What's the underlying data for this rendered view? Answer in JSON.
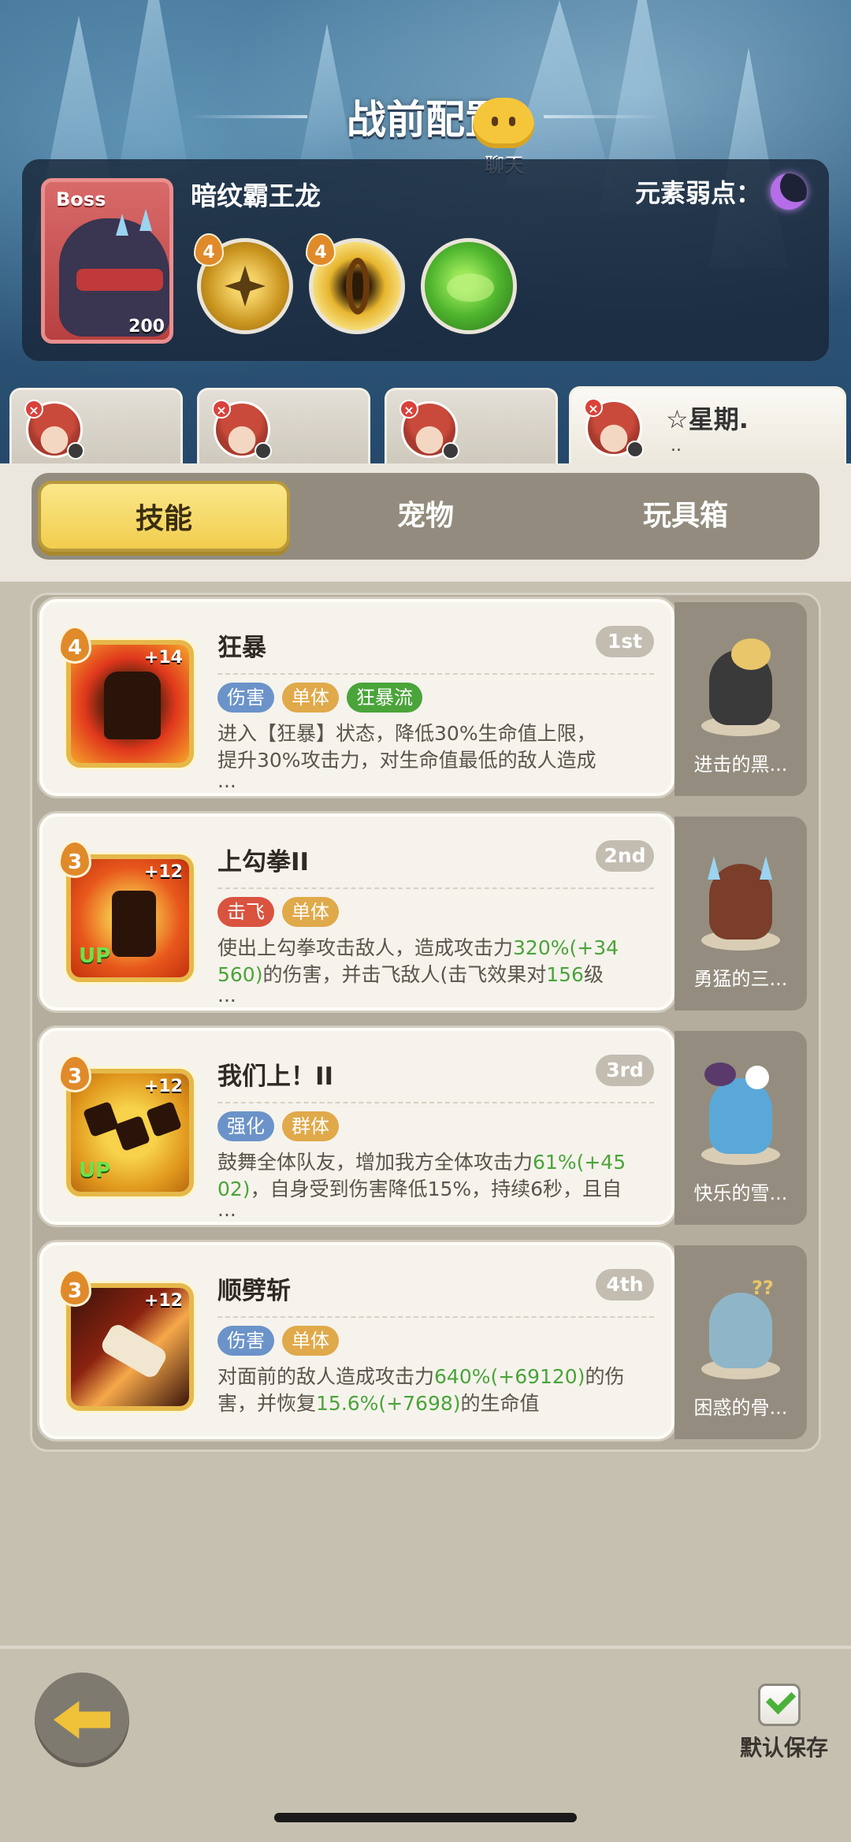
{
  "page_title": "战前配置",
  "chat_label": "聊天",
  "boss": {
    "tag": "Boss",
    "name": "暗纹霸王龙",
    "level": "200",
    "weakness_label": "元素弱点：",
    "weakness_icon": "moon-icon",
    "skills": [
      {
        "badge": "4",
        "icon": "star-burst-icon"
      },
      {
        "badge": "4",
        "icon": "gold-ring-icon"
      },
      {
        "badge": "",
        "icon": "green-slime-icon"
      }
    ]
  },
  "team_tabs": [
    {
      "label": "",
      "sub": ""
    },
    {
      "label": "",
      "sub": ""
    },
    {
      "label": "",
      "sub": ""
    },
    {
      "label": "☆星期.",
      "sub": ".."
    }
  ],
  "tabs": {
    "skills": "技能",
    "pets": "宠物",
    "toybox": "玩具箱"
  },
  "skills": [
    {
      "level": "4",
      "plus": "+14",
      "up": "",
      "name": "狂暴",
      "rank": "1st",
      "tags": [
        {
          "text": "伤害",
          "color": "#6b93c9"
        },
        {
          "text": "单体",
          "color": "#e0a94a"
        },
        {
          "text": "狂暴流",
          "color": "#4aa43a"
        }
      ],
      "desc_line1": "进入【狂暴】状态，降低30%生命值上限，",
      "desc_line2": "提升30%攻击力，对生命值最低的敌人造成",
      "desc_line3": "...",
      "pet_name": "进击的黑..."
    },
    {
      "level": "3",
      "plus": "+12",
      "up": "UP",
      "name": "上勾拳II",
      "rank": "2nd",
      "tags": [
        {
          "text": "击飞",
          "color": "#d9533f"
        },
        {
          "text": "单体",
          "color": "#e0a94a"
        }
      ],
      "desc_a": "使出上勾拳攻击敌人，造成攻击力",
      "desc_hl1": "320%(+34",
      "desc_hl2": "560)",
      "desc_b": "的伤害，并击飞敌人(击飞效果对",
      "desc_hl3": "156",
      "desc_c": "级",
      "desc_line3": "...",
      "pet_name": "勇猛的三..."
    },
    {
      "level": "3",
      "plus": "+12",
      "up": "UP",
      "name": "我们上！II",
      "rank": "3rd",
      "tags": [
        {
          "text": "强化",
          "color": "#6b93c9"
        },
        {
          "text": "群体",
          "color": "#e0a94a"
        }
      ],
      "desc_a": "鼓舞全体队友，增加我方全体攻击力",
      "desc_hl1": "61%(+45",
      "desc_hl2": "02)",
      "desc_b": "，自身受到伤害降低15%，持续6秒，且自",
      "desc_line3": "...",
      "pet_name": "快乐的雪..."
    },
    {
      "level": "3",
      "plus": "+12",
      "up": "",
      "name": "顺劈斩",
      "rank": "4th",
      "tags": [
        {
          "text": "伤害",
          "color": "#6b93c9"
        },
        {
          "text": "单体",
          "color": "#e0a94a"
        }
      ],
      "desc_a": "对面前的敌人造成攻击力",
      "desc_hl1": "640%(+69120)",
      "desc_b": "的伤",
      "desc_c": "害，并恢复",
      "desc_hl2": "15.6%(+7698)",
      "desc_d": "的生命值",
      "pet_name": "困惑的骨..."
    }
  ],
  "footer": {
    "save_label": "默认保存"
  }
}
